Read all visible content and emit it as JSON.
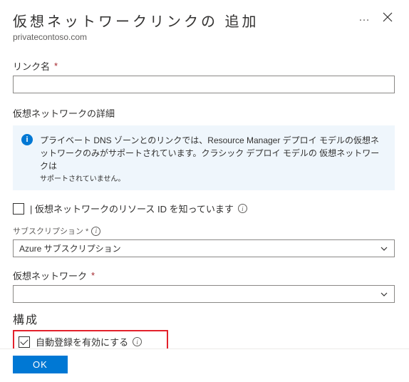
{
  "header": {
    "title": "仮想ネットワークリンクの 追加",
    "subtitle": "privatecontoso.com"
  },
  "link_name": {
    "label": "リンク名",
    "value": ""
  },
  "vnet_details_heading": "仮想ネットワークの詳細",
  "infobar": {
    "line1": "プライベート DNS ゾーンとのリンクでは、Resource Manager デプロイ モデルの仮想ネットワークのみがサポートされています。クラシック デプロイ モデルの 仮想ネットワークは",
    "line2": "サポートされていません。"
  },
  "know_resource_id": {
    "label": "| 仮想ネットワークのリソース ID を知っています",
    "checked": false
  },
  "subscription": {
    "label": "サブスクリプション *",
    "selected": "Azure サブスクリプション"
  },
  "vnet": {
    "label": "仮想ネットワーク",
    "selected": ""
  },
  "config_heading": "構成",
  "auto_register": {
    "label": "自動登録を有効にする",
    "checked": true
  },
  "footer": {
    "ok": "OK"
  }
}
